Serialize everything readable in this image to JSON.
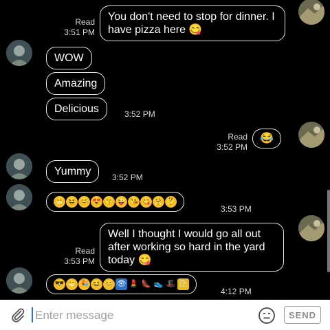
{
  "messages": [
    {
      "direction": "outgoing",
      "text": "You don't need to stop for dinner. I have pizza here 😋",
      "status": "Read",
      "time": "3:51 PM"
    },
    {
      "direction": "incoming",
      "text": "WOW"
    },
    {
      "direction": "incoming",
      "text": "Amazing"
    },
    {
      "direction": "incoming",
      "text": "Delicious",
      "time": "3:52 PM"
    },
    {
      "direction": "outgoing",
      "text": "😂",
      "status": "Read",
      "time": "3:52 PM"
    },
    {
      "direction": "incoming",
      "text": "Yummy",
      "time": "3:52 PM"
    },
    {
      "direction": "incoming",
      "emojis": [
        "grinning-face",
        "laughing-face",
        "smiling-face",
        "heart-eyes-face",
        "kissing-face",
        "winking-face",
        "kissing-heart-face",
        "yum-face",
        "hugging-face",
        "thinking-face"
      ],
      "time": "3:53 PM"
    },
    {
      "direction": "outgoing",
      "text": "Well I thought I would go all out after working so hard in the yard today 😋",
      "status": "Read",
      "time": "3:53 PM"
    },
    {
      "direction": "incoming",
      "emojis": [
        "sunglasses-face",
        "grinning-face",
        "party-popper",
        "laughing-face",
        "smiling-face",
        "eye-icon",
        "lipstick",
        "high-heel",
        "sneaker",
        "top-hat",
        "gift-bag"
      ],
      "time": "4:12 PM"
    }
  ],
  "input": {
    "placeholder": "Enter message",
    "value": ""
  },
  "send_label": "SEND",
  "colors": {
    "background": "#000000",
    "bubble_border": "#e8e8e8",
    "text": "#ffffff",
    "input_bar": "#ffffff",
    "cursor": "#2a76c6"
  }
}
